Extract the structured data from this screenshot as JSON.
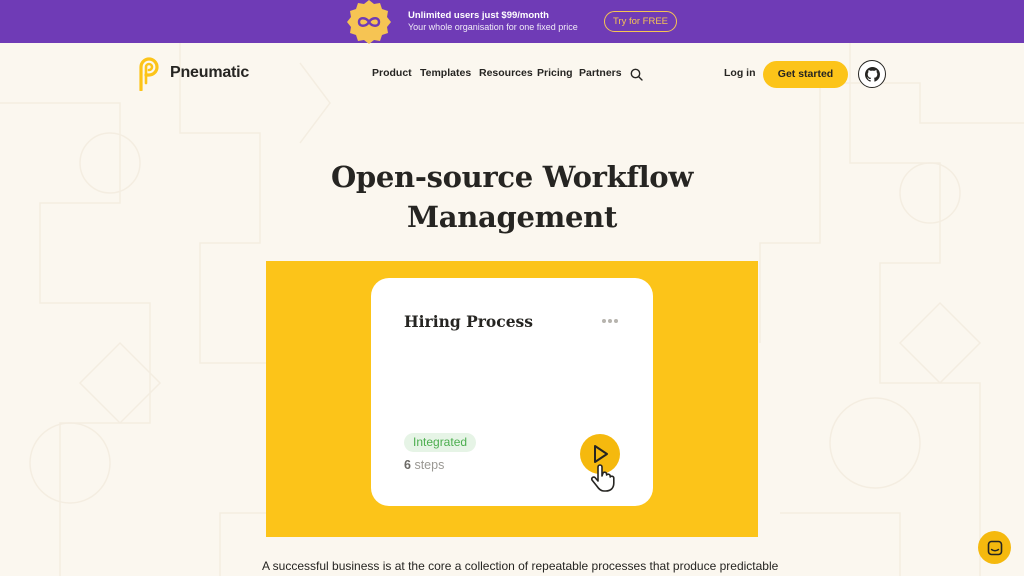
{
  "promo": {
    "title": "Unlimited users just $99/month",
    "subtitle": "Your whole organisation for one fixed price",
    "cta_label": "Try for FREE",
    "badge_icon": "infinity-icon",
    "background_color": "#6f3bb6",
    "accent_color": "#f6c453"
  },
  "header": {
    "brand": "Pneumatic",
    "nav": [
      "Product",
      "Templates",
      "Resources",
      "Pricing",
      "Partners"
    ],
    "search_icon": "search-icon",
    "login_label": "Log in",
    "cta_label": "Get started",
    "github_icon": "github-icon",
    "accent_color": "#fcc419"
  },
  "hero": {
    "title_line1": "Open-source Workflow",
    "title_line2": "Management",
    "card": {
      "title": "Hiring Process",
      "badge": "Integrated",
      "steps_count": "6",
      "steps_label": "steps"
    },
    "description": "A successful business is at the core a collection of repeatable processes that produce predictable"
  },
  "chat": {
    "icon": "chat-icon"
  }
}
